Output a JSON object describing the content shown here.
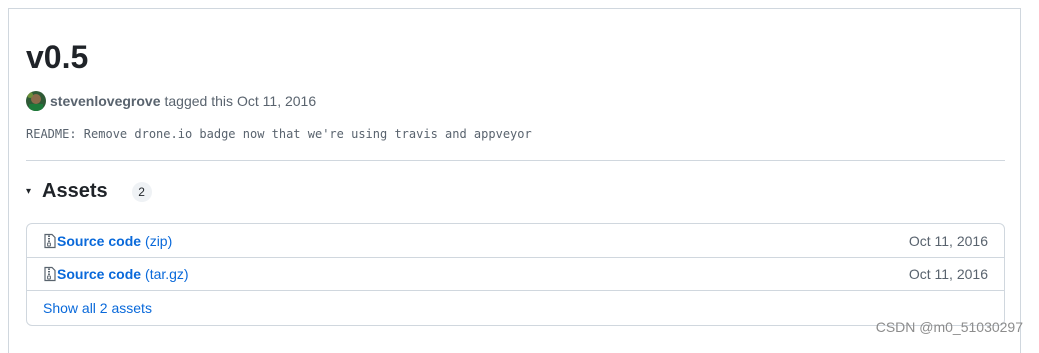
{
  "release": {
    "title": "v0.5",
    "author": "stevenlovegrove",
    "tagged_text": "tagged this",
    "date": "Oct 11, 2016",
    "commit_message": "README: Remove drone.io badge now that we're using travis and appveyor"
  },
  "assets": {
    "caret": "▾",
    "title": "Assets",
    "count": "2",
    "items": [
      {
        "label": "Source code",
        "ext": "(zip)",
        "date": "Oct 11, 2016",
        "icon": "file-zip-icon"
      },
      {
        "label": "Source code",
        "ext": "(tar.gz)",
        "date": "Oct 11, 2016",
        "icon": "file-zip-icon"
      }
    ],
    "show_all_label": "Show all 2 assets"
  },
  "watermark": "CSDN @m0_51030297",
  "colors": {
    "link": "#0969da",
    "muted": "#59636e",
    "border": "#d0d7de"
  }
}
